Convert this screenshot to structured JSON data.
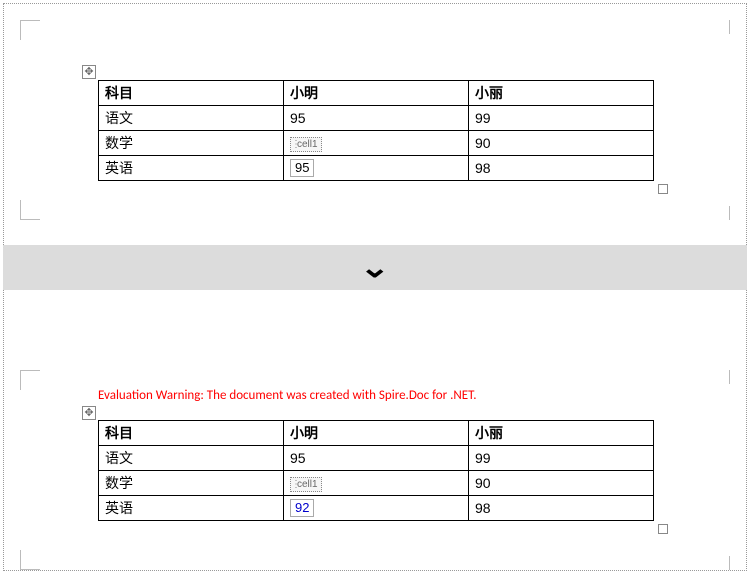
{
  "warning_text": "Evaluation Warning: The document was created with Spire.Doc for .NET.",
  "headers": {
    "c0": "科目",
    "c1": "小明",
    "c2": "小丽"
  },
  "rows_top": {
    "r0": {
      "c0": "语文",
      "c1": "95",
      "c2": "99"
    },
    "r1": {
      "c0": "数学",
      "c1_tag": "cell1",
      "c2": "90"
    },
    "r2": {
      "c0": "英语",
      "c1_field": "95",
      "c2": "98"
    }
  },
  "rows_bottom": {
    "r0": {
      "c0": "语文",
      "c1": "95",
      "c2": "99"
    },
    "r1": {
      "c0": "数学",
      "c1_tag": "cell1",
      "c2": "90"
    },
    "r2": {
      "c0": "英语",
      "c1_field": "92",
      "c2": "98"
    }
  },
  "divider_icon": "chevron-down"
}
